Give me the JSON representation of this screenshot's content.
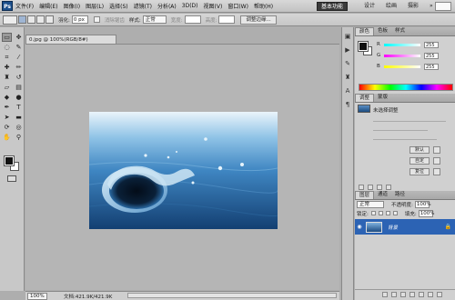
{
  "app": {
    "logo": "Ps"
  },
  "menu": [
    "文件(F)",
    "编辑(E)",
    "图像(I)",
    "图层(L)",
    "选择(S)",
    "滤镜(T)",
    "分析(A)",
    "3D(D)",
    "视图(V)",
    "窗口(W)",
    "帮助(H)"
  ],
  "menubar": {
    "zoom": "100%"
  },
  "workspace": {
    "active": "基本功能",
    "items": [
      "设计",
      "绘画",
      "摄影",
      "»"
    ]
  },
  "options": {
    "feather_label": "羽化:",
    "feather_value": "0 px",
    "antialias_label": "消除锯齿",
    "style_label": "样式:",
    "style_value": "正常",
    "width_label": "宽度:",
    "height_label": "高度:",
    "refine_button": "调整边缘..."
  },
  "document": {
    "tab_title": "0.jpg @ 100%(RGB/8#)",
    "zoom": "100%",
    "doc_info": "文档:421.9K/421.9K"
  },
  "color_panel": {
    "tabs": [
      "颜色",
      "色板",
      "样式"
    ],
    "r_label": "R",
    "g_label": "G",
    "b_label": "B",
    "r": "255",
    "g": "255",
    "b": "255"
  },
  "adjust_panel": {
    "tabs": [
      "调整",
      "蒙版"
    ],
    "title": "未选择调整",
    "buttons": [
      "默认",
      "自定",
      "复位"
    ]
  },
  "layers_panel": {
    "tabs": [
      "图层",
      "通道",
      "路径"
    ],
    "blend": "正常",
    "opacity_label": "不透明度:",
    "opacity": "100%",
    "lock_label": "锁定:",
    "fill_label": "填充:",
    "fill": "100%",
    "layer_name": "背景"
  },
  "colors": {
    "accent": "#2c63b4",
    "active_workspace": "#3a3a3a"
  }
}
